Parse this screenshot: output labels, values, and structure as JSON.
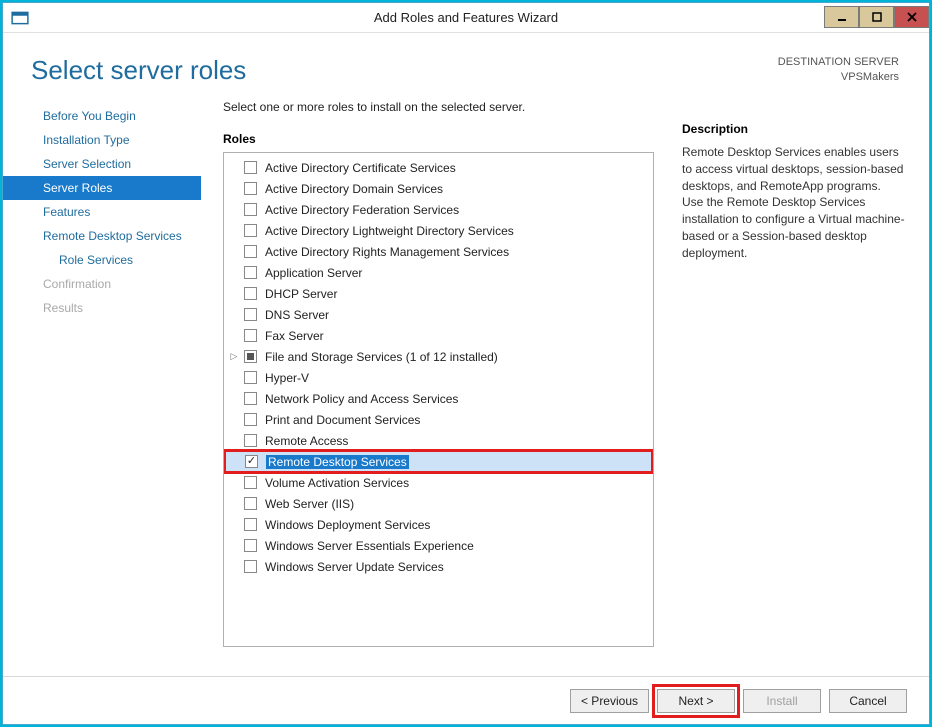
{
  "window": {
    "title": "Add Roles and Features Wizard"
  },
  "header": {
    "page_title": "Select server roles",
    "dest_label": "DESTINATION SERVER",
    "dest_name": "VPSMakers"
  },
  "nav": {
    "items": [
      {
        "label": "Before You Begin",
        "state": "normal"
      },
      {
        "label": "Installation Type",
        "state": "normal"
      },
      {
        "label": "Server Selection",
        "state": "normal"
      },
      {
        "label": "Server Roles",
        "state": "selected"
      },
      {
        "label": "Features",
        "state": "normal"
      },
      {
        "label": "Remote Desktop Services",
        "state": "normal"
      },
      {
        "label": "Role Services",
        "state": "normal",
        "sub": true
      },
      {
        "label": "Confirmation",
        "state": "disabled"
      },
      {
        "label": "Results",
        "state": "disabled"
      }
    ]
  },
  "main": {
    "instruction": "Select one or more roles to install on the selected server.",
    "roles_heading": "Roles",
    "roles": [
      {
        "label": "Active Directory Certificate Services",
        "checked": "none"
      },
      {
        "label": "Active Directory Domain Services",
        "checked": "none"
      },
      {
        "label": "Active Directory Federation Services",
        "checked": "none"
      },
      {
        "label": "Active Directory Lightweight Directory Services",
        "checked": "none"
      },
      {
        "label": "Active Directory Rights Management Services",
        "checked": "none"
      },
      {
        "label": "Application Server",
        "checked": "none"
      },
      {
        "label": "DHCP Server",
        "checked": "none"
      },
      {
        "label": "DNS Server",
        "checked": "none"
      },
      {
        "label": "Fax Server",
        "checked": "none"
      },
      {
        "label": "File and Storage Services (1 of 12 installed)",
        "checked": "partial",
        "expander": true
      },
      {
        "label": "Hyper-V",
        "checked": "none"
      },
      {
        "label": "Network Policy and Access Services",
        "checked": "none"
      },
      {
        "label": "Print and Document Services",
        "checked": "none"
      },
      {
        "label": "Remote Access",
        "checked": "none"
      },
      {
        "label": "Remote Desktop Services",
        "checked": "checked",
        "selected": true,
        "highlight": true
      },
      {
        "label": "Volume Activation Services",
        "checked": "none"
      },
      {
        "label": "Web Server (IIS)",
        "checked": "none"
      },
      {
        "label": "Windows Deployment Services",
        "checked": "none"
      },
      {
        "label": "Windows Server Essentials Experience",
        "checked": "none"
      },
      {
        "label": "Windows Server Update Services",
        "checked": "none"
      }
    ]
  },
  "description": {
    "heading": "Description",
    "text": "Remote Desktop Services enables users to access virtual desktops, session-based desktops, and RemoteApp programs. Use the Remote Desktop Services installation to configure a Virtual machine-based or a Session-based desktop deployment."
  },
  "footer": {
    "previous": "< Previous",
    "next": "Next >",
    "install": "Install",
    "cancel": "Cancel"
  }
}
